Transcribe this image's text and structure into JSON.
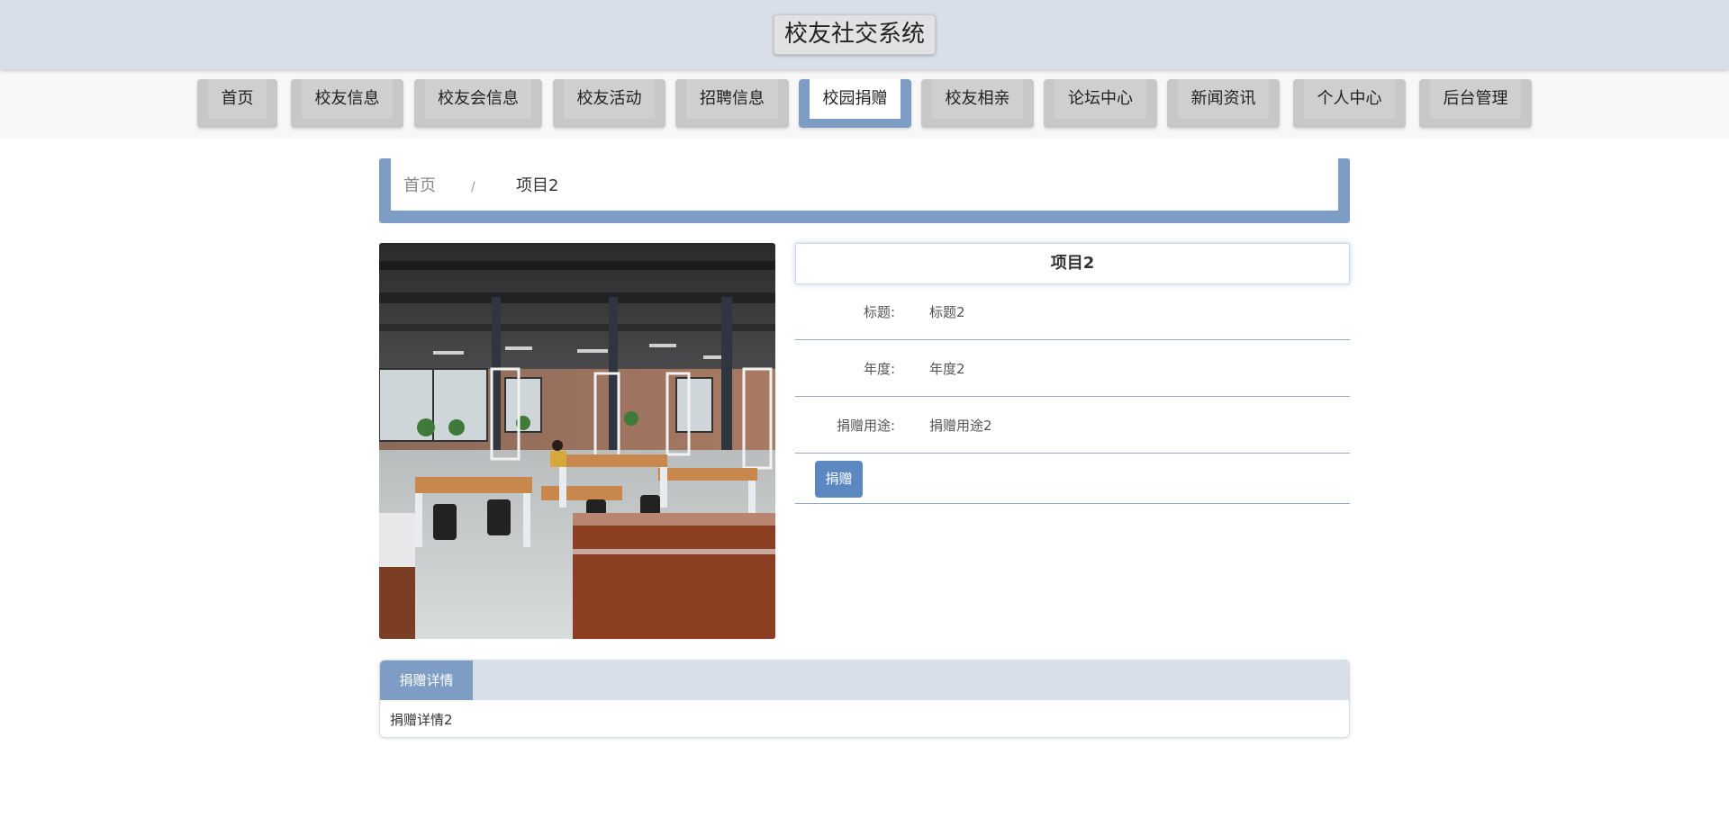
{
  "header": {
    "title": "校友社交系统"
  },
  "nav": {
    "items": [
      {
        "label": "首页"
      },
      {
        "label": "校友信息"
      },
      {
        "label": "校友会信息"
      },
      {
        "label": "校友活动"
      },
      {
        "label": "招聘信息"
      },
      {
        "label": "校园捐赠",
        "active": true
      },
      {
        "label": "校友相亲"
      },
      {
        "label": "论坛中心"
      },
      {
        "label": "新闻资讯"
      },
      {
        "label": "个人中心"
      },
      {
        "label": "后台管理"
      }
    ]
  },
  "breadcrumb": {
    "home": "首页",
    "separator": "/",
    "current": "项目2"
  },
  "detail": {
    "title": "项目2",
    "fields": [
      {
        "label": "标题:",
        "value": "标题2"
      },
      {
        "label": "年度:",
        "value": "年度2"
      },
      {
        "label": "捐赠用途:",
        "value": "捐赠用途2"
      }
    ],
    "donate_button": "捐赠"
  },
  "tabs": {
    "active_label": "捐赠详情",
    "content": "捐赠详情2"
  },
  "colors": {
    "accent": "#7e9dc4",
    "header_bg": "#d8dfe8",
    "button": "#5b88c0"
  }
}
